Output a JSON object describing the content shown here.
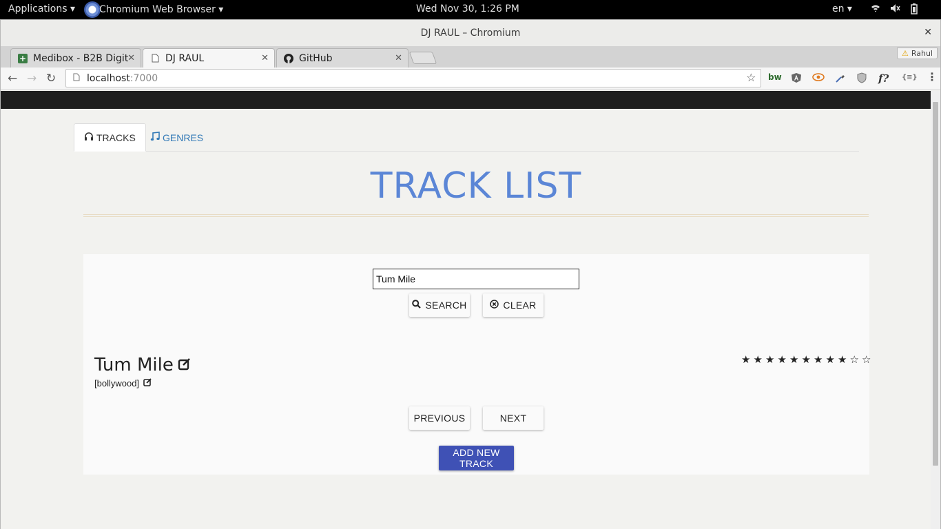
{
  "system_bar": {
    "applications": "Applications ▾",
    "browser_menu": "Chromium Web Browser ▾",
    "clock": "Wed Nov 30,  1:26 PM",
    "lang": "en ▾"
  },
  "window": {
    "title": "DJ RAUL – Chromium"
  },
  "tabs": [
    {
      "label": "Medibox - B2B Digit",
      "active": false
    },
    {
      "label": "DJ RAUL",
      "active": true
    },
    {
      "label": "GitHub",
      "active": false
    }
  ],
  "profile_name": "Rahul",
  "omnibox": {
    "host": "localhost",
    "port": ":7000"
  },
  "page": {
    "nav_tabs": [
      {
        "label": "TRACKS",
        "icon": "headphones-icon",
        "active": true
      },
      {
        "label": "GENRES",
        "icon": "music-note-icon",
        "active": false
      }
    ],
    "title": "TRACK LIST",
    "search": {
      "value": "Tum Mile",
      "search_label": "SEARCH",
      "clear_label": "CLEAR"
    },
    "track": {
      "name": "Tum Mile",
      "genre": "[bollywood]",
      "rating": 9,
      "rating_max": 11
    },
    "pagination": {
      "previous_label": "PREVIOUS",
      "next_label": "NEXT"
    },
    "add_track_label": "ADD NEW TRACK"
  },
  "colors": {
    "title": "#5b86d6",
    "primary_button": "#3f51b5",
    "link": "#337ab7"
  }
}
